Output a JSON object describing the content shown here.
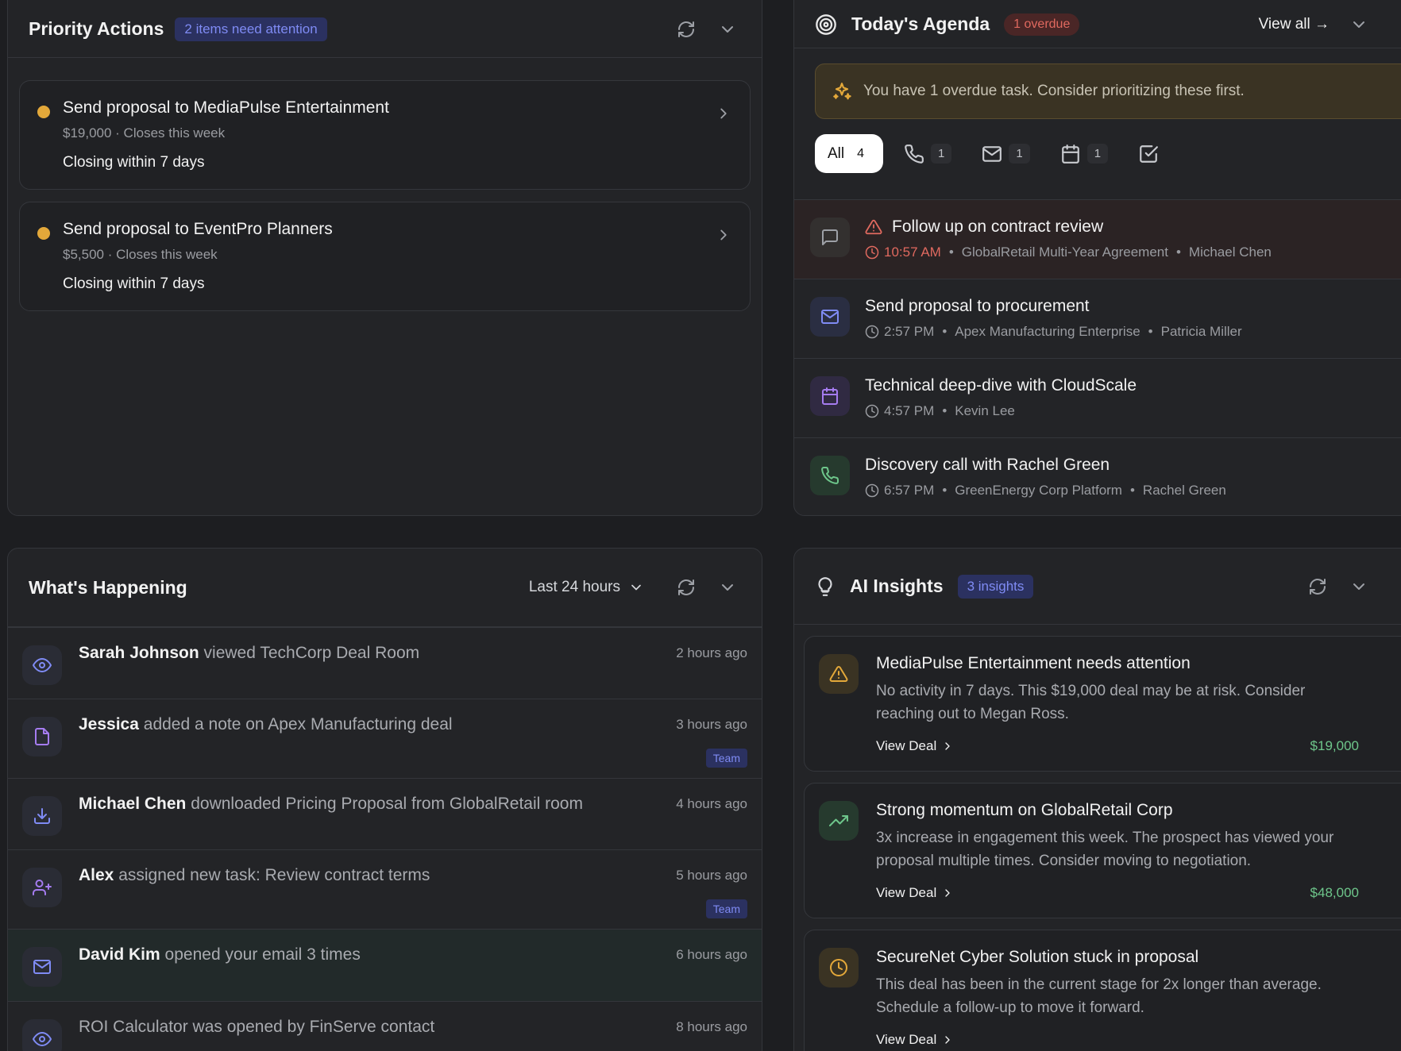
{
  "priority_actions": {
    "title": "Priority Actions",
    "badge": "2 items need attention",
    "items": [
      {
        "title": "Send proposal to MediaPulse Entertainment",
        "sub": "$19,000 · Closes this week",
        "closing": "Closing within 7 days"
      },
      {
        "title": "Send proposal to EventPro Planners",
        "sub": "$5,500 · Closes this week",
        "closing": "Closing within 7 days"
      }
    ]
  },
  "agenda": {
    "title": "Today's Agenda",
    "overdue_badge": "1 overdue",
    "view_all": "View all →",
    "notice": "You have 1 overdue task. Consider prioritizing these first.",
    "filters": {
      "all_label": "All",
      "all_count": "4",
      "calls": "1",
      "emails": "1",
      "meetings": "1"
    },
    "items": [
      {
        "title": "Follow up on contract review",
        "time": "10:57 AM",
        "deal": "GlobalRetail Multi-Year Agreement",
        "person": "Michael Chen",
        "icon": "message-icon"
      },
      {
        "title": "Send proposal to procurement",
        "time": "2:57 PM",
        "deal": "Apex Manufacturing Enterprise",
        "person": "Patricia Miller",
        "icon": "mail-icon"
      },
      {
        "title": "Technical deep-dive with CloudScale",
        "time": "4:57 PM",
        "person": "Kevin Lee",
        "icon": "calendar-icon"
      },
      {
        "title": "Discovery call with Rachel Green",
        "time": "6:57 PM",
        "deal": "GreenEnergy Corp Platform",
        "person": "Rachel Green",
        "icon": "phone-icon"
      }
    ]
  },
  "happening": {
    "title": "What's Happening",
    "range": "Last 24 hours",
    "team_label": "Team",
    "items": [
      {
        "actor": "Sarah Johnson",
        "text": "viewed TechCorp Deal Room",
        "time": "2 hours ago"
      },
      {
        "actor": "Jessica",
        "text": "added a note on Apex Manufacturing deal",
        "time": "3 hours ago"
      },
      {
        "actor": "Michael Chen",
        "text": "downloaded Pricing Proposal from GlobalRetail room",
        "time": "4 hours ago"
      },
      {
        "actor": "Alex",
        "text": "assigned new task: Review contract terms",
        "time": "5 hours ago"
      },
      {
        "actor": "David Kim",
        "text": "opened your email 3 times",
        "time": "6 hours ago"
      },
      {
        "actor": "",
        "text": "ROI Calculator was opened by FinServe contact",
        "time": "8 hours ago"
      }
    ]
  },
  "insights": {
    "title": "AI Insights",
    "badge": "3 insights",
    "view_deal": "View Deal",
    "items": [
      {
        "title": "MediaPulse Entertainment needs attention",
        "body": "No activity in 7 days. This $19,000 deal may be at risk. Consider reaching out to Megan Ross.",
        "amount": "$19,000"
      },
      {
        "title": "Strong momentum on GlobalRetail Corp",
        "body": "3x increase in engagement this week. The prospect has viewed your proposal multiple times. Consider moving to negotiation.",
        "amount": "$48,000"
      },
      {
        "title": "SecureNet Cyber Solution stuck in proposal",
        "body": "This deal has been in the current stage for 2x longer than average. Schedule a follow-up to move it forward."
      }
    ]
  },
  "colors": {
    "accent": "#7f8bf4",
    "warning": "#e3a83a",
    "danger": "#e0695f",
    "success": "#6ec68b"
  }
}
